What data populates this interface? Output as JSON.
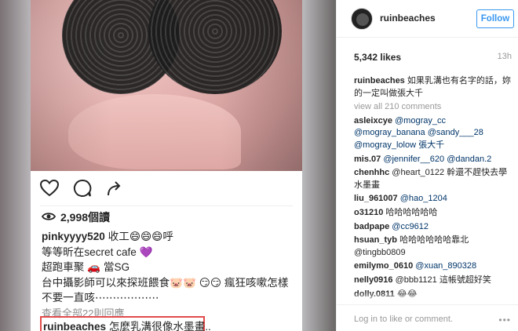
{
  "post": {
    "views": "2,998個讀",
    "first_comment": {
      "user": "pinkyyyy520",
      "lines": [
        "收工😄😄😄呼",
        "等等昕在secret cafe 💜",
        "超跑車聚 🚗 當SG",
        "台中攝影師可以來探班餵食🐷🐷 😏😏 瘋狂咳嗽怎樣",
        "不要一直咳⋯⋯⋯⋯⋯⋯"
      ]
    },
    "view_all": "查看全部22則回應",
    "highlight": {
      "user": "ruinbeaches",
      "text": "怎麼乳溝很像水墨畫.."
    },
    "accent": "#e24b4b"
  },
  "panel": {
    "username": "ruinbeaches",
    "follow_label": "Follow",
    "likes": "5,342 likes",
    "time": "13h",
    "caption_user": "ruinbeaches",
    "caption": "如果乳溝也有名字的話，妳的一定叫做張大千",
    "view_all": "view all 210 comments",
    "comments": [
      {
        "user": "asleixcye",
        "text": "@mogray_cc @mogray_banana @sandy___28 @mogray_lolow 張大千"
      },
      {
        "user": "mis.07",
        "text": "@jennifer__620 @dandan.2"
      },
      {
        "user": "chenhhc",
        "text": "@heart_0122 幹還不趕快去學水墨畫"
      },
      {
        "user": "liu_961007",
        "text": "@hao_1204"
      },
      {
        "user": "o31210",
        "text": "哈哈哈哈哈哈"
      },
      {
        "user": "badpape",
        "text": "@cc9612"
      },
      {
        "user": "hsuan_tyb",
        "text": "哈哈哈哈哈哈靠北 @tingbb0809"
      },
      {
        "user": "emilymo_0610",
        "text": "@xuan_890328"
      },
      {
        "user": "nelly0916",
        "text": "@bbb1121 這帳號超好笑"
      },
      {
        "user": "dolly.0811",
        "text": "😂😂"
      }
    ],
    "login_text": "Log in to like or comment.",
    "more": "•••",
    "link_color": "#003569",
    "button_color": "#3897f0"
  },
  "icons": [
    "heart-icon",
    "comment-icon",
    "share-icon",
    "eye-icon"
  ]
}
